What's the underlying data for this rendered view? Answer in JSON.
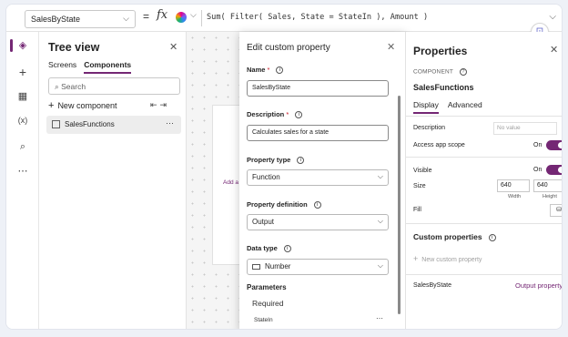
{
  "formula_bar": {
    "property": "SalesByState",
    "equals": "=",
    "fx": "fx",
    "formula": "Sum( Filter( Sales, State = StateIn ), Amount )"
  },
  "tree": {
    "title": "Tree view",
    "tabs": [
      "Screens",
      "Components"
    ],
    "search_placeholder": "Search",
    "new_component": "New component",
    "item": "SalesFunctions"
  },
  "canvas": {
    "hint": "Add a"
  },
  "dialog": {
    "title": "Edit custom property",
    "name_label": "Name",
    "name_value": "SalesByState",
    "desc_label": "Description",
    "desc_value": "Calculates sales for a state",
    "ptype_label": "Property type",
    "ptype_value": "Function",
    "pdef_label": "Property definition",
    "pdef_value": "Output",
    "dtype_label": "Data type",
    "dtype_value": "Number",
    "params_label": "Parameters",
    "required_label": "Required",
    "param_item": "StateIn"
  },
  "properties": {
    "title": "Properties",
    "kind": "COMPONENT",
    "name": "SalesFunctions",
    "tabs": [
      "Display",
      "Advanced"
    ],
    "description_label": "Description",
    "description_placeholder": "No value",
    "access_label": "Access app scope",
    "access_state": "On",
    "visible_label": "Visible",
    "visible_state": "On",
    "size_label": "Size",
    "width_value": "640",
    "height_value": "640",
    "width_caption": "Width",
    "height_caption": "Height",
    "fill_label": "Fill",
    "custom_title": "Custom properties",
    "new_custom": "New custom property",
    "custom_item_name": "SalesByState",
    "custom_item_type": "Output property"
  },
  "colors": {
    "accent": "#742774"
  }
}
